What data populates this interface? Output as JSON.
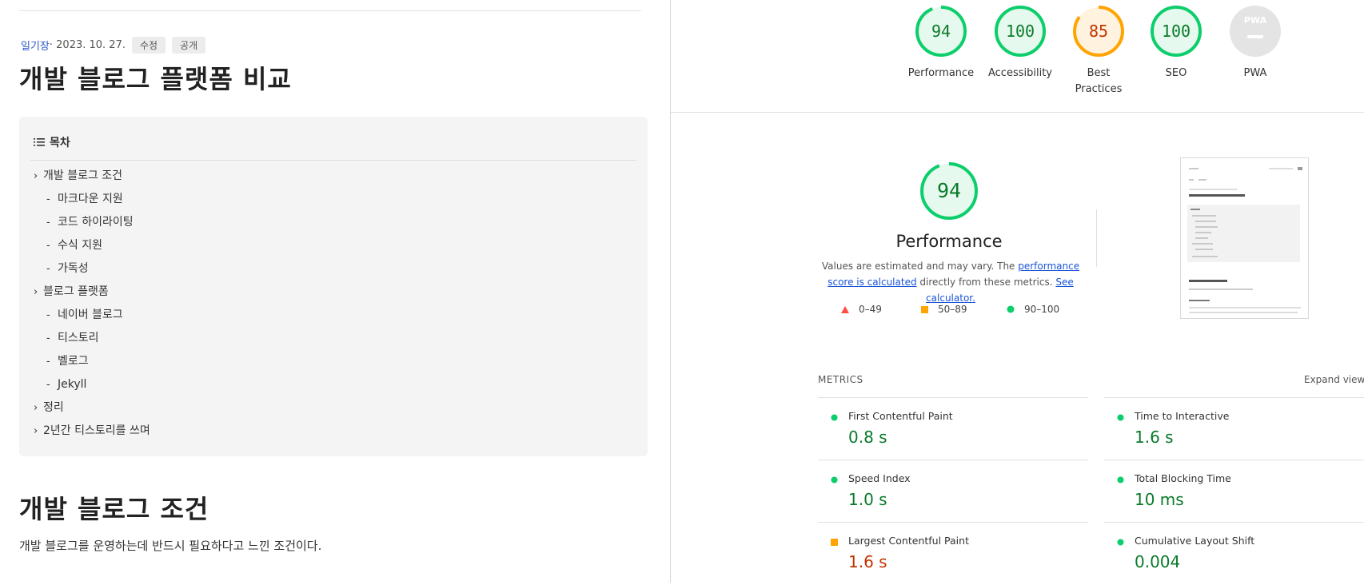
{
  "blog": {
    "category": "일기장",
    "date": "· 2023. 10. 27.",
    "tag_edit": "수정",
    "tag_public": "공개",
    "title": "개발 블로그 플랫폼 비교",
    "toc_title": "목차",
    "toc": [
      {
        "label": "개발 블로그 조건",
        "level": 1
      },
      {
        "label": "마크다운 지원",
        "level": 2
      },
      {
        "label": "코드 하이라이팅",
        "level": 2
      },
      {
        "label": "수식 지원",
        "level": 2
      },
      {
        "label": "가독성",
        "level": 2
      },
      {
        "label": "블로그 플랫폼",
        "level": 1
      },
      {
        "label": "네이버 블로그",
        "level": 2
      },
      {
        "label": "티스토리",
        "level": 2
      },
      {
        "label": "벨로그",
        "level": 2
      },
      {
        "label": "Jekyll",
        "level": 2
      },
      {
        "label": "정리",
        "level": 1
      },
      {
        "label": "2년간 티스토리를 쓰며",
        "level": 1
      }
    ],
    "section_title": "개발 블로그 조건",
    "section_text": "개발 블로그를 운영하는데 반드시 필요하다고 느낀 조건이다."
  },
  "lighthouse": {
    "colors": {
      "pass": "#0cce6b",
      "average": "#ffa400",
      "fail": "#ff4e42",
      "pass_text": "#0a7a2a",
      "average_text": "#c33300",
      "pwa": "#cccccc"
    },
    "scores": [
      {
        "label": "Performance",
        "value": "94",
        "status": "pass"
      },
      {
        "label": "Accessibility",
        "value": "100",
        "status": "pass"
      },
      {
        "label": "Best Practices",
        "value": "85",
        "status": "average"
      },
      {
        "label": "SEO",
        "value": "100",
        "status": "pass"
      },
      {
        "label": "PWA",
        "value": "",
        "status": "pwa"
      }
    ],
    "pwa_badge": "PWA",
    "perf": {
      "score": "94",
      "title": "Performance",
      "desc_prefix": "Values are estimated and may vary. The ",
      "desc_link": "performance score is calculated",
      "desc_mid": " directly from these metrics. ",
      "desc_link2": "See calculator."
    },
    "legend": [
      {
        "range": "0–49",
        "icon": "triangle-icon"
      },
      {
        "range": "50–89",
        "icon": "square-icon"
      },
      {
        "range": "90–100",
        "icon": "circle-icon"
      }
    ],
    "metrics_label": "METRICS",
    "expand_label": "Expand view",
    "metrics": [
      {
        "label": "First Contentful Paint",
        "value": "0.8 s",
        "status": "pass"
      },
      {
        "label": "Time to Interactive",
        "value": "1.6 s",
        "status": "pass"
      },
      {
        "label": "Speed Index",
        "value": "1.0 s",
        "status": "pass"
      },
      {
        "label": "Total Blocking Time",
        "value": "10 ms",
        "status": "pass"
      },
      {
        "label": "Largest Contentful Paint",
        "value": "1.6 s",
        "status": "average"
      },
      {
        "label": "Cumulative Layout Shift",
        "value": "0.004",
        "status": "pass"
      }
    ]
  }
}
